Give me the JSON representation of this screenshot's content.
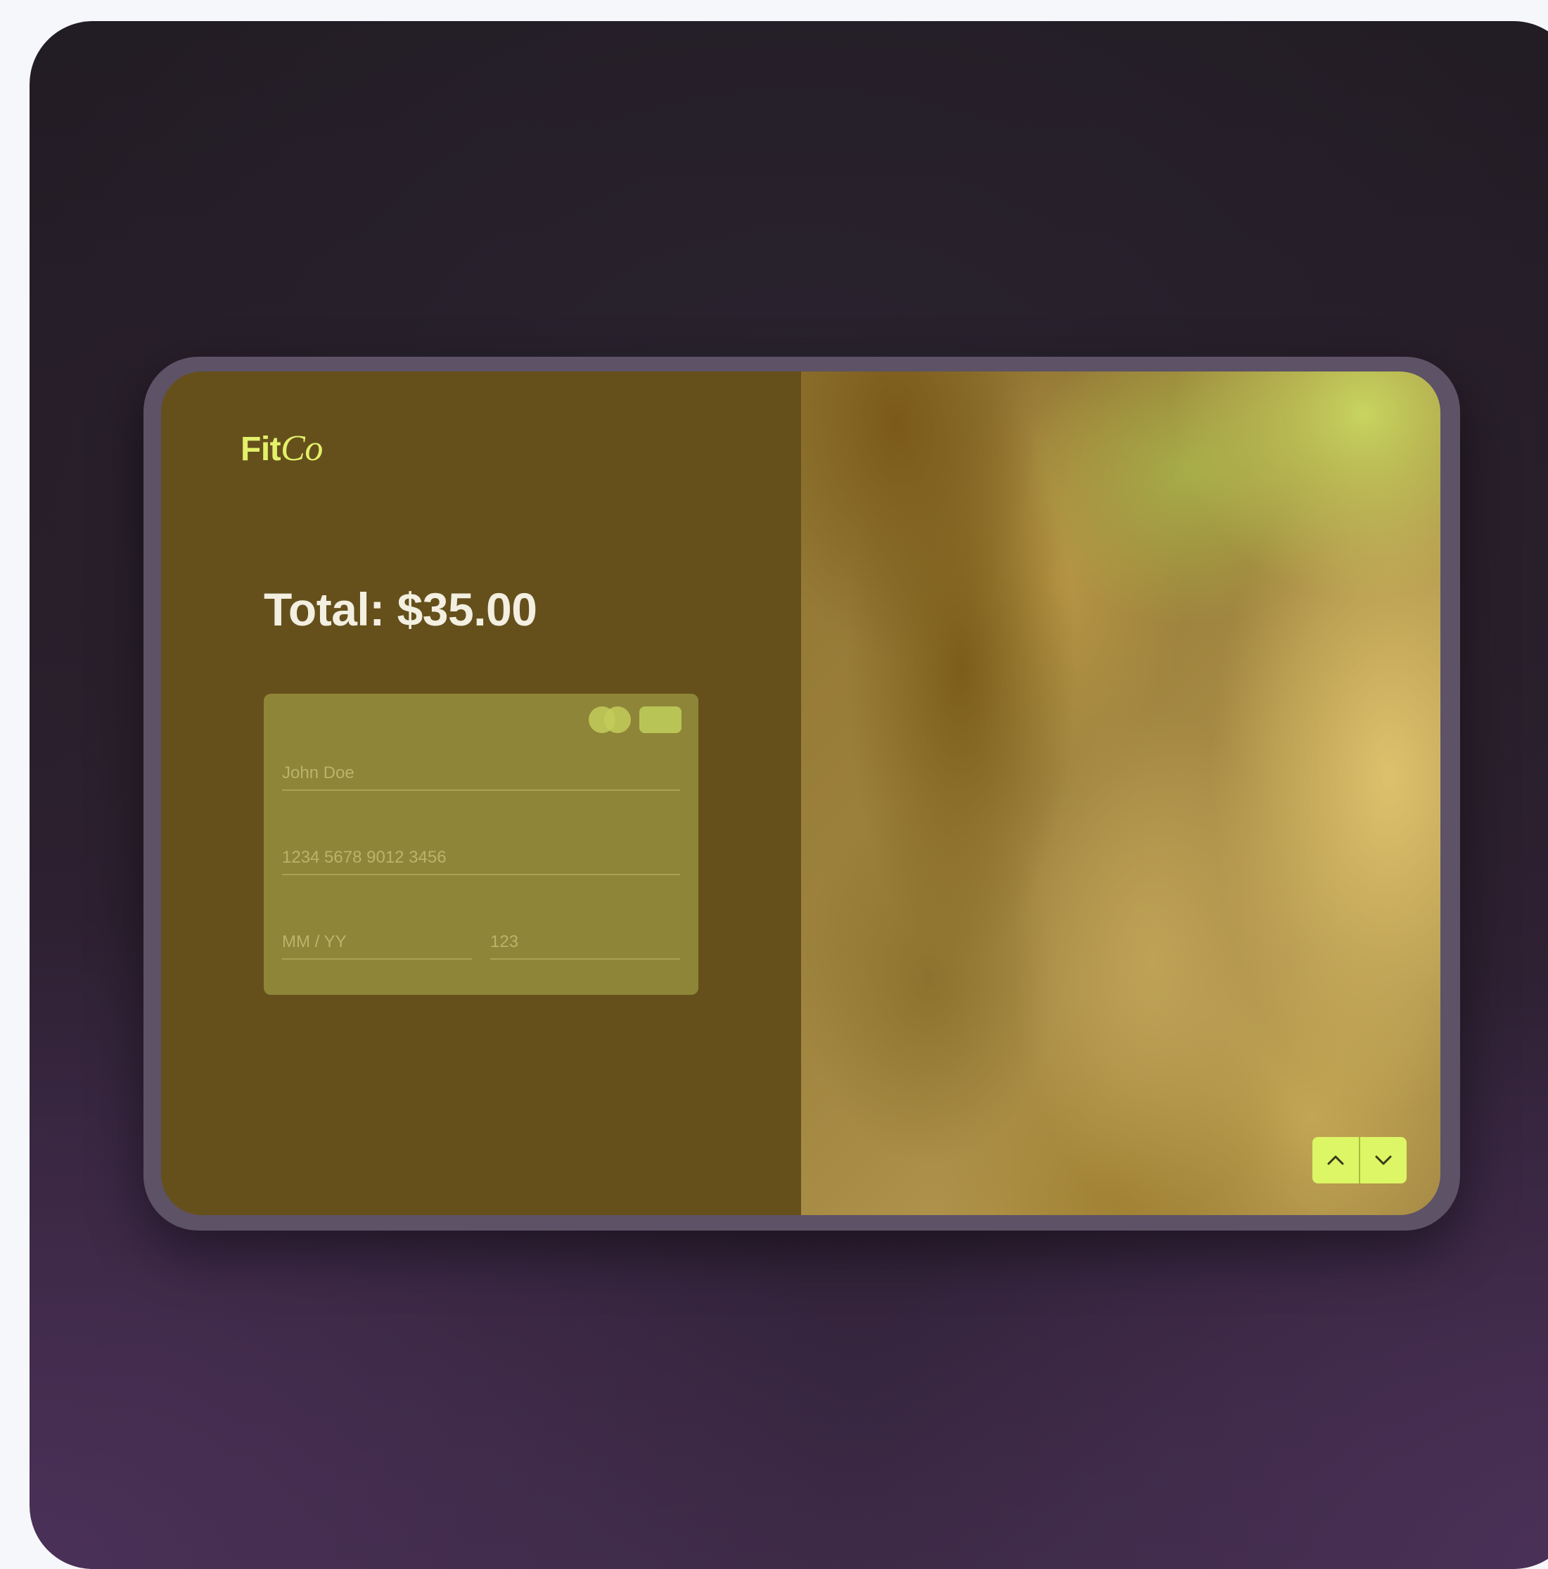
{
  "brand": {
    "name_part1": "Fit",
    "name_part2": "Co"
  },
  "checkout": {
    "total_label": "Total: $35.00"
  },
  "payment_card": {
    "icons": [
      "mastercard-icon",
      "generic-card-icon"
    ],
    "name_value": "John Doe",
    "number_value": "1234 5678 9012 3456",
    "expiry_value": "MM / YY",
    "cvc_value": "123"
  },
  "pager": {
    "icons": [
      "chevron-up-icon",
      "chevron-down-icon"
    ]
  },
  "colors": {
    "accent": "#dcf56b",
    "brand": "#e3f06a",
    "left_panel": "#65501c",
    "card": "#8e8538",
    "frame": "#5d5266"
  }
}
